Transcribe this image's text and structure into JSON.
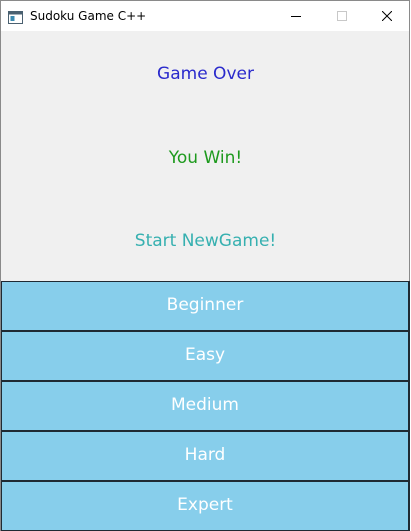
{
  "window": {
    "title": "Sudoku Game C++",
    "controls": {
      "minimize_icon": "minimize-icon",
      "maximize_icon": "maximize-icon",
      "close_icon": "close-icon"
    }
  },
  "messages": {
    "game_over": "Game Over",
    "you_win": "You Win!",
    "start_new_game": "Start NewGame!"
  },
  "levels": {
    "beginner": "Beginner",
    "easy": "Easy",
    "medium": "Medium",
    "hard": "Hard",
    "expert": "Expert"
  },
  "colors": {
    "game_over_text": "#2a2acc",
    "you_win_text": "#1e9a1e",
    "new_game_text": "#36b0b0",
    "button_bg": "#87ceeb",
    "button_text": "#ffffff",
    "content_bg": "#f0f0f0"
  }
}
